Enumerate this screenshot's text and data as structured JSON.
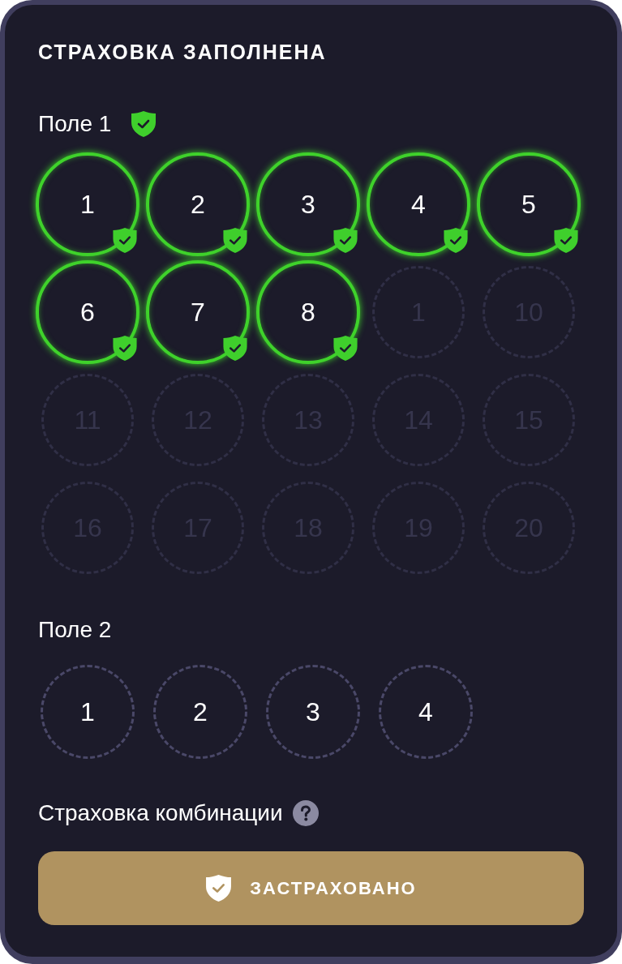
{
  "title": "СТРАХОВКА ЗАПОЛНЕНА",
  "fields": [
    {
      "label": "Поле 1",
      "insured": true,
      "numbers": [
        {
          "label": "1",
          "insured": true,
          "disabled": false
        },
        {
          "label": "2",
          "insured": true,
          "disabled": false
        },
        {
          "label": "3",
          "insured": true,
          "disabled": false
        },
        {
          "label": "4",
          "insured": true,
          "disabled": false
        },
        {
          "label": "5",
          "insured": true,
          "disabled": false
        },
        {
          "label": "6",
          "insured": true,
          "disabled": false
        },
        {
          "label": "7",
          "insured": true,
          "disabled": false
        },
        {
          "label": "8",
          "insured": true,
          "disabled": false
        },
        {
          "label": "1",
          "insured": false,
          "disabled": true
        },
        {
          "label": "10",
          "insured": false,
          "disabled": true
        },
        {
          "label": "11",
          "insured": false,
          "disabled": true
        },
        {
          "label": "12",
          "insured": false,
          "disabled": true
        },
        {
          "label": "13",
          "insured": false,
          "disabled": true
        },
        {
          "label": "14",
          "insured": false,
          "disabled": true
        },
        {
          "label": "15",
          "insured": false,
          "disabled": true
        },
        {
          "label": "16",
          "insured": false,
          "disabled": true
        },
        {
          "label": "17",
          "insured": false,
          "disabled": true
        },
        {
          "label": "18",
          "insured": false,
          "disabled": true
        },
        {
          "label": "19",
          "insured": false,
          "disabled": true
        },
        {
          "label": "20",
          "insured": false,
          "disabled": true
        }
      ]
    },
    {
      "label": "Поле 2",
      "insured": false,
      "numbers": [
        {
          "label": "1",
          "insured": false,
          "disabled": false
        },
        {
          "label": "2",
          "insured": false,
          "disabled": false
        },
        {
          "label": "3",
          "insured": false,
          "disabled": false
        },
        {
          "label": "4",
          "insured": false,
          "disabled": false
        }
      ]
    }
  ],
  "combination": {
    "label": "Страховка комбинации"
  },
  "insure_button": {
    "label": "ЗАСТРАХОВАНО"
  }
}
